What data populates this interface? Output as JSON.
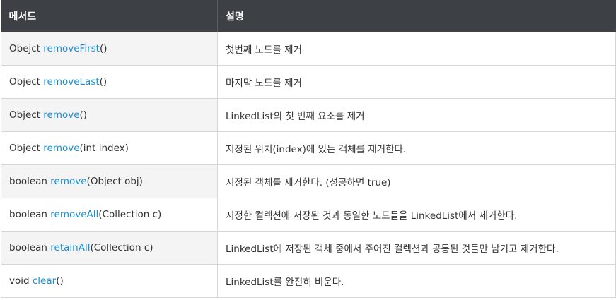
{
  "header": {
    "method": "메서드",
    "description": "설명"
  },
  "rows": [
    {
      "ret": "Obejct",
      "name": "removeFirst",
      "params": "()",
      "desc": "첫번째 노드를 제거"
    },
    {
      "ret": "Object",
      "name": "removeLast",
      "params": "()",
      "desc": "마지막 노드를 제거"
    },
    {
      "ret": "Object",
      "name": "remove",
      "params": "()",
      "desc": "LinkedList의 첫 번째 요소를 제거"
    },
    {
      "ret": "Object",
      "name": "remove",
      "params": "(int index)",
      "desc": "지정된 위치(index)에 있는 객체를 제거한다."
    },
    {
      "ret": "boolean",
      "name": "remove",
      "params": "(Object obj)",
      "desc": "지정된 객체를 제거한다. (성공하면 true)"
    },
    {
      "ret": "boolean",
      "name": "removeAll",
      "params": "(Collection c)",
      "desc": "지정한 컬렉션에 저장된 것과 동일한 노드들을 LinkedList에서 제거한다."
    },
    {
      "ret": "boolean",
      "name": "retainAll",
      "params": "(Collection c)",
      "desc": "LinkedList에 저장된 객체 중에서 주어진 컬렉션과 공통된 것들만 남기고 제거한다."
    },
    {
      "ret": "void",
      "name": "clear",
      "params": "()",
      "desc": "LinkedList를 완전히 비운다."
    }
  ],
  "colors": {
    "header_bg": "#3d4044",
    "method_link": "#1a8ed1"
  }
}
